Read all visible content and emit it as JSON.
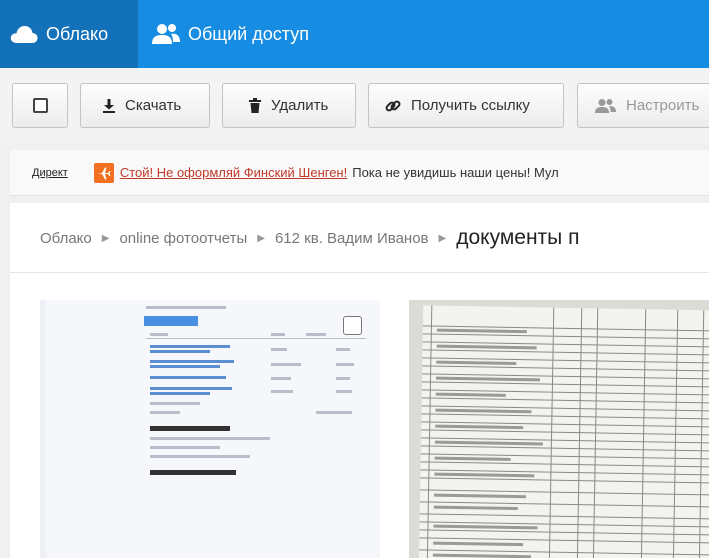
{
  "nav": {
    "cloud_label": "Облако",
    "share_label": "Общий доступ"
  },
  "toolbar": {
    "download_label": "Скачать",
    "delete_label": "Удалить",
    "get_link_label": "Получить ссылку",
    "settings_label": "Настроить"
  },
  "ad": {
    "label": "Директ",
    "link_text": "Стой! Не оформляй Финский Шенген!",
    "body_text": "Пока не увидишь наши цены! Мул"
  },
  "breadcrumb": {
    "items": [
      "Облако",
      "online фотоотчеты",
      "612 кв. Вадим Иванов"
    ],
    "current": "документы п"
  },
  "colors": {
    "header": "#168de2",
    "header_active": "#1271b9",
    "ad_icon": "#f37021"
  }
}
